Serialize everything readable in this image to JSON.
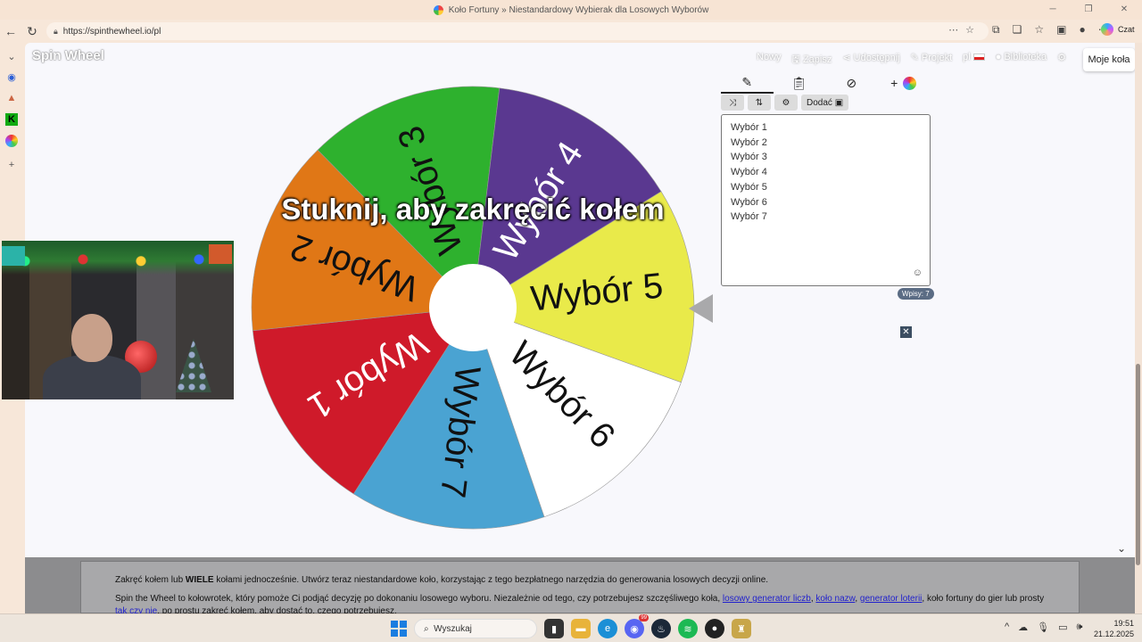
{
  "window": {
    "title": "Koło Fortuny » Niestandardowy Wybierak dla Losowych Wyborów"
  },
  "browser": {
    "url": "https://spinthewheel.io/pl",
    "copilot_label": "Czat"
  },
  "site": {
    "logo": "Spin Wheel",
    "nav": [
      "Nowy",
      "Zapisz",
      "Udostępnij",
      "Projekt",
      "pl",
      "Biblioteka"
    ],
    "my_wheels": "Moje koła"
  },
  "wheel": {
    "spin_hint": "Stuknij, aby zakręcić kołem",
    "segments": [
      {
        "label": "Wybór 1",
        "color": "#cf1a2a"
      },
      {
        "label": "Wybór 2",
        "color": "#e07716"
      },
      {
        "label": "Wybór 3",
        "color": "#2eb12e"
      },
      {
        "label": "Wybór 4",
        "color": "#5a3890"
      },
      {
        "label": "Wybór 5",
        "color": "#e9ea4a"
      },
      {
        "label": "Wybór 6",
        "color": "#ffffff"
      },
      {
        "label": "Wybór 7",
        "color": "#4aa3d2"
      }
    ]
  },
  "editor": {
    "add_label": "Dodać",
    "entries": [
      "Wybór 1",
      "Wybór 2",
      "Wybór 3",
      "Wybór 4",
      "Wybór 5",
      "Wybór 6",
      "Wybór 7"
    ],
    "count_label": "Wpisy: 7"
  },
  "footer": {
    "line1_pre": "Zakręć kołem lub ",
    "line1_bold": "WIELE",
    "line1_post": " kołami jednocześnie. Utwórz teraz niestandardowe koło, korzystając z tego bezpłatnego narzędzia do generowania losowych decyzji online.",
    "line2_pre": "Spin the Wheel to kołowrotek, który pomoże Ci podjąć decyzję po dokonaniu losowego wyboru. Niezależnie od tego, czy potrzebujesz szczęśliwego koła, ",
    "link1": "losowy generator liczb",
    "link2": "koło nazw",
    "link3": "generator loterii",
    "line2_mid": ", koło fortuny do gier lub prosty ",
    "link4": "tak czy nie",
    "line2_post": ", po prostu zakręć kołem, aby dostać to, czego potrzebujesz."
  },
  "taskbar": {
    "search_placeholder": "Wyszukaj",
    "time": "19:51",
    "date": "21.12.2025",
    "discord_badge": "99"
  }
}
